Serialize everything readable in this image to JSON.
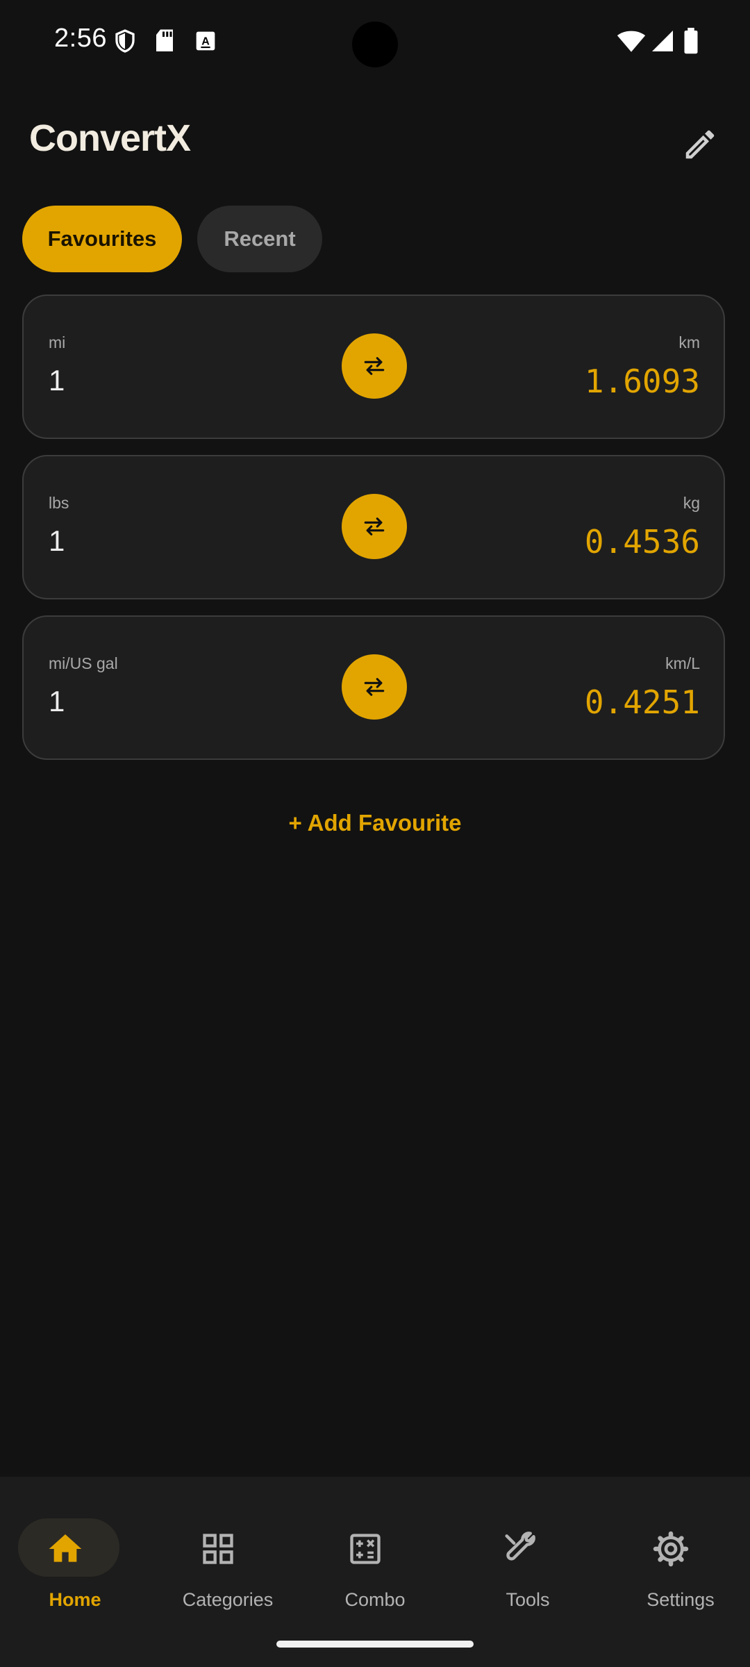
{
  "status_bar": {
    "time": "2:56",
    "left_icons": [
      "shield-icon",
      "sd-card-icon",
      "keyboard-a-icon"
    ],
    "right_icons": [
      "wifi-icon",
      "signal-icon",
      "battery-icon"
    ]
  },
  "header": {
    "title": "ConvertX",
    "edit_icon": "pencil-icon"
  },
  "tabs": [
    {
      "label": "Favourites",
      "active": true
    },
    {
      "label": "Recent",
      "active": false
    }
  ],
  "conversions": [
    {
      "from_unit": "mi",
      "from_value": "1",
      "to_unit": "km",
      "to_value": "1.6093"
    },
    {
      "from_unit": "lbs",
      "from_value": "1",
      "to_unit": "kg",
      "to_value": "0.4536"
    },
    {
      "from_unit": "mi/US gal",
      "from_value": "1",
      "to_unit": "km/L",
      "to_value": "0.4251"
    }
  ],
  "add_favourite_label": "+ Add Favourite",
  "bottom_nav": [
    {
      "label": "Home",
      "icon": "home-icon",
      "active": true
    },
    {
      "label": "Categories",
      "icon": "grid-icon",
      "active": false
    },
    {
      "label": "Combo",
      "icon": "calculator-icon",
      "active": false
    },
    {
      "label": "Tools",
      "icon": "wrench-icon",
      "active": false
    },
    {
      "label": "Settings",
      "icon": "gear-icon",
      "active": false
    }
  ],
  "colors": {
    "accent": "#e2a500",
    "background": "#121212",
    "card": "#1e1e1e",
    "nav_bar": "#1c1c1c"
  }
}
